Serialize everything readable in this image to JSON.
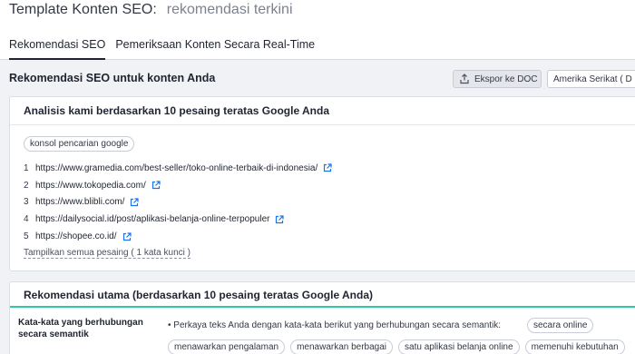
{
  "header": {
    "title": "Template Konten SEO:",
    "subtitle": "rekomendasi terkini"
  },
  "tabs": [
    {
      "label": "Rekomendasi SEO",
      "active": true
    },
    {
      "label": "Pemeriksaan Konten Secara Real-Time",
      "active": false
    }
  ],
  "section": {
    "title": "Rekomendasi SEO untuk konten Anda",
    "export_label": "Ekspor ke DOC",
    "country_label": "Amerika Serikat  ( D"
  },
  "analysis": {
    "title": "Analisis kami berdasarkan 10 pesaing teratas Google Anda",
    "keyword": "konsol pencarian google",
    "competitors": [
      {
        "num": "1",
        "url": "https://www.gramedia.com/best-seller/toko-online-terbaik-di-indonesia/"
      },
      {
        "num": "2",
        "url": "https://www.tokopedia.com/"
      },
      {
        "num": "3",
        "url": "https://www.blibli.com/"
      },
      {
        "num": "4",
        "url": "https://dailysocial.id/post/aplikasi-belanja-online-terpopuler"
      },
      {
        "num": "5",
        "url": "https://shopee.co.id/"
      }
    ],
    "show_all": "Tampilkan semua pesaing ( 1 kata kunci )"
  },
  "recommendations": {
    "title": "Rekomendasi utama (berdasarkan 10 pesaing teratas Google Anda)",
    "row_label": "Kata-kata yang berhubungan secara semantik",
    "row_text": "• Perkaya teks Anda dengan kata-kata berikut yang berhubungan secara semantik:",
    "words": [
      "secara online",
      "menawarkan pengalaman",
      "menawarkan berbagai",
      "satu aplikasi belanja online",
      "memenuhi kebutuhan"
    ]
  },
  "colors": {
    "accent_line": "#2fc8a9",
    "link_icon": "#1a73e8",
    "background": "#f1f2f6"
  }
}
